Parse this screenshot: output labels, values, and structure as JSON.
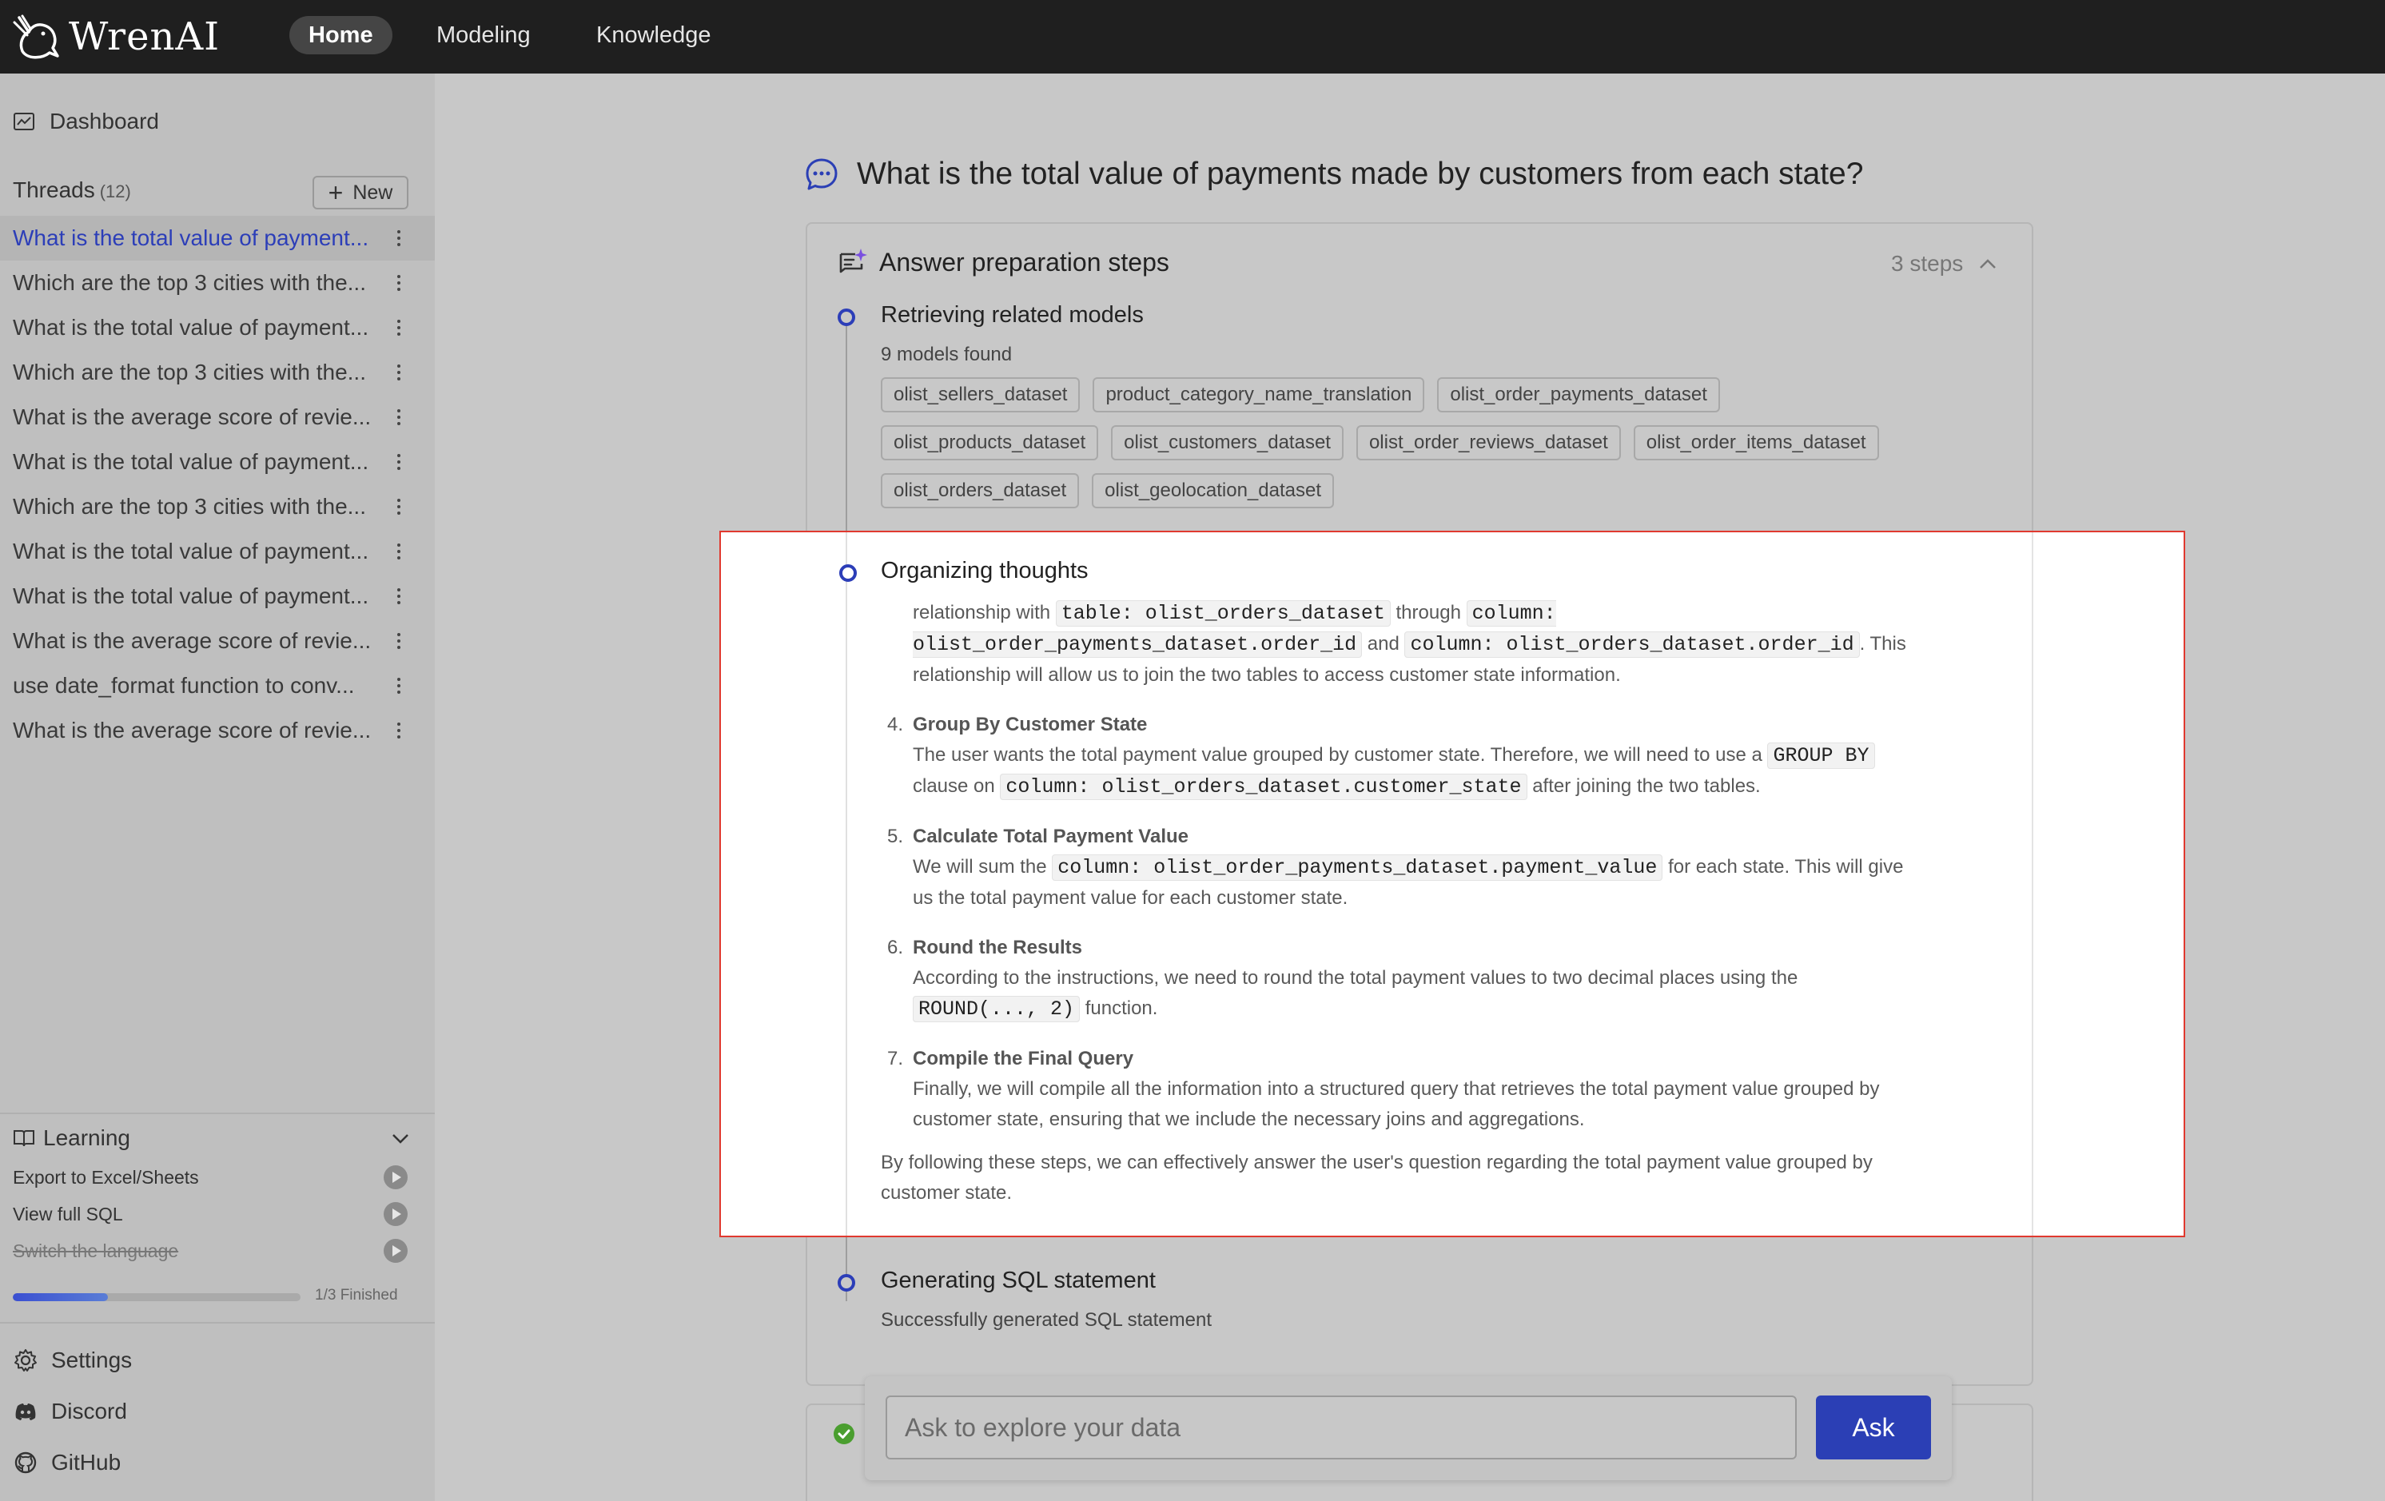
{
  "app": {
    "name": "WrenAI"
  },
  "nav": {
    "home": "Home",
    "modeling": "Modeling",
    "knowledge": "Knowledge"
  },
  "sidebar": {
    "dashboard": "Dashboard",
    "threads_label": "Threads",
    "threads_count": "(12)",
    "new_label": "New",
    "threads": [
      "What is the total value of payment...",
      "Which are the top 3 cities with the...",
      "What is the total value of payment...",
      "Which are the top 3 cities with the...",
      "What is the average score of revie...",
      "What is the total value of payment...",
      "Which are the top 3 cities with the...",
      "What is the total value of payment...",
      "What is the total value of payment...",
      "What is the average score of revie...",
      "use date_format function to conv...",
      "What is the average score of revie..."
    ],
    "learning": {
      "title": "Learning",
      "items": [
        "Export to Excel/Sheets",
        "View full SQL",
        "Switch the language"
      ],
      "progress_text": "1/3 Finished",
      "progress_fraction": 0.33
    },
    "settings": "Settings",
    "discord": "Discord",
    "github": "GitHub"
  },
  "main": {
    "question": "What is the total value of payments made by customers from each state?",
    "steps_title": "Answer preparation steps",
    "steps_count": "3 steps",
    "step1": {
      "title": "Retrieving related models",
      "subtitle": "9 models found",
      "models": [
        "olist_sellers_dataset",
        "product_category_name_translation",
        "olist_order_payments_dataset",
        "olist_products_dataset",
        "olist_customers_dataset",
        "olist_order_reviews_dataset",
        "olist_order_items_dataset",
        "olist_orders_dataset",
        "olist_geolocation_dataset"
      ]
    },
    "step2": {
      "title": "Organizing thoughts",
      "intro_1": "relationship with",
      "intro_code_1": "table: olist_orders_dataset",
      "intro_2": "through",
      "intro_code_2": "column: olist_order_payments_dataset.order_id",
      "intro_3": "and",
      "intro_code_3": "column: olist_orders_dataset.order_id",
      "intro_4": ". This relationship will allow us to join the two tables to access customer state information.",
      "item4_num": "4.",
      "item4_head": "Group By Customer State",
      "item4_text_1": "The user wants the total payment value grouped by customer state. Therefore, we will need to use a",
      "item4_code_1": "GROUP BY",
      "item4_text_2": "clause on",
      "item4_code_2": "column: olist_orders_dataset.customer_state",
      "item4_text_3": "after joining the two tables.",
      "item5_num": "5.",
      "item5_head": "Calculate Total Payment Value",
      "item5_text_1": "We will sum the",
      "item5_code_1": "column: olist_order_payments_dataset.payment_value",
      "item5_text_2": "for each state. This will give us the total payment value for each customer state.",
      "item6_num": "6.",
      "item6_head": "Round the Results",
      "item6_text_1": "According to the instructions, we need to round the total payment values to two decimal places using the",
      "item6_code_1": "ROUND(..., 2)",
      "item6_text_2": "function.",
      "item7_num": "7.",
      "item7_head": "Compile the Final Query",
      "item7_text": "Finally, we will compile all the information into a structured query that retrieves the total payment value grouped by customer state, ensuring that we include the necessary joins and aggregations.",
      "conclusion": "By following these steps, we can effectively answer the user's question regarding the total payment value grouped by customer state."
    },
    "step3": {
      "title": "Generating SQL statement",
      "subtitle": "Successfully generated SQL statement"
    },
    "ask": {
      "placeholder": "Ask to explore your data",
      "button": "Ask"
    }
  },
  "colors": {
    "accent": "#2b3fb5",
    "highlight_border": "#e0392f",
    "topbar": "#1f1f1f",
    "success": "#52c41a"
  }
}
